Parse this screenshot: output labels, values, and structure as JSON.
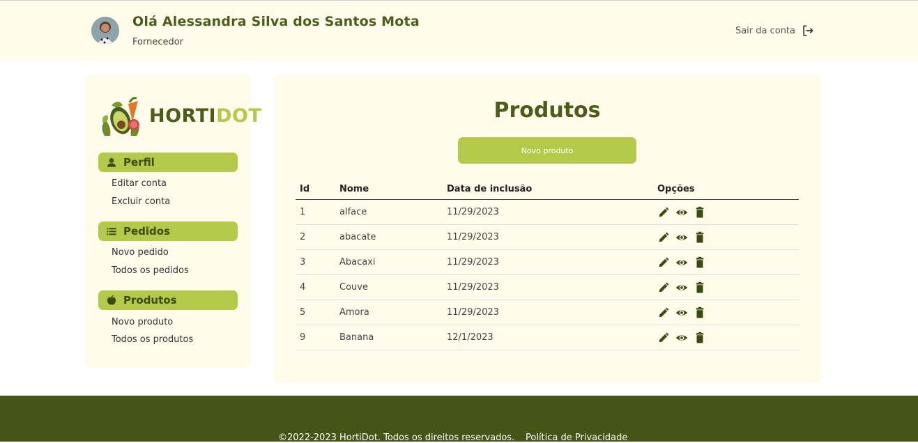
{
  "header": {
    "greeting": "Olá Alessandra Silva dos Santos Mota",
    "role": "Fornecedor",
    "logout_label": "Sair da conta"
  },
  "sidebar": {
    "logo": {
      "part1": "HORTI",
      "part2": "DOT"
    },
    "sections": [
      {
        "label": "Perfil",
        "icon": "person-icon",
        "links": [
          "Editar conta",
          "Excluir conta"
        ]
      },
      {
        "label": "Pedidos",
        "icon": "list-icon",
        "links": [
          "Novo pedido",
          "Todos os pedidos"
        ]
      },
      {
        "label": "Produtos",
        "icon": "apple-icon",
        "links": [
          "Novo produto",
          "Todos os produtos"
        ]
      }
    ]
  },
  "main": {
    "title": "Produtos",
    "new_button": "Novo produto",
    "table": {
      "headers": [
        "Id",
        "Nome",
        "Data de inclusão",
        "Opções"
      ],
      "rows": [
        {
          "id": "1",
          "name": "alface",
          "date": "11/29/2023"
        },
        {
          "id": "2",
          "name": "abacate",
          "date": "11/29/2023"
        },
        {
          "id": "3",
          "name": "Abacaxi",
          "date": "11/29/2023"
        },
        {
          "id": "4",
          "name": "Couve",
          "date": "11/29/2023"
        },
        {
          "id": "5",
          "name": "Amora",
          "date": "11/29/2023"
        },
        {
          "id": "9",
          "name": "Banana",
          "date": "12/1/2023"
        }
      ],
      "row_actions": [
        "edit-icon",
        "view-icon",
        "delete-icon"
      ]
    }
  },
  "footer": {
    "copyright": "©2022-2023 HortiDot. Todos os direitos reservados.",
    "privacy_link": "Política de Privacidade"
  },
  "colors": {
    "dark_green": "#4a5d1a",
    "accent": "#b3c94a",
    "panel_bg": "#fefbea",
    "footer_bg": "#455417"
  }
}
